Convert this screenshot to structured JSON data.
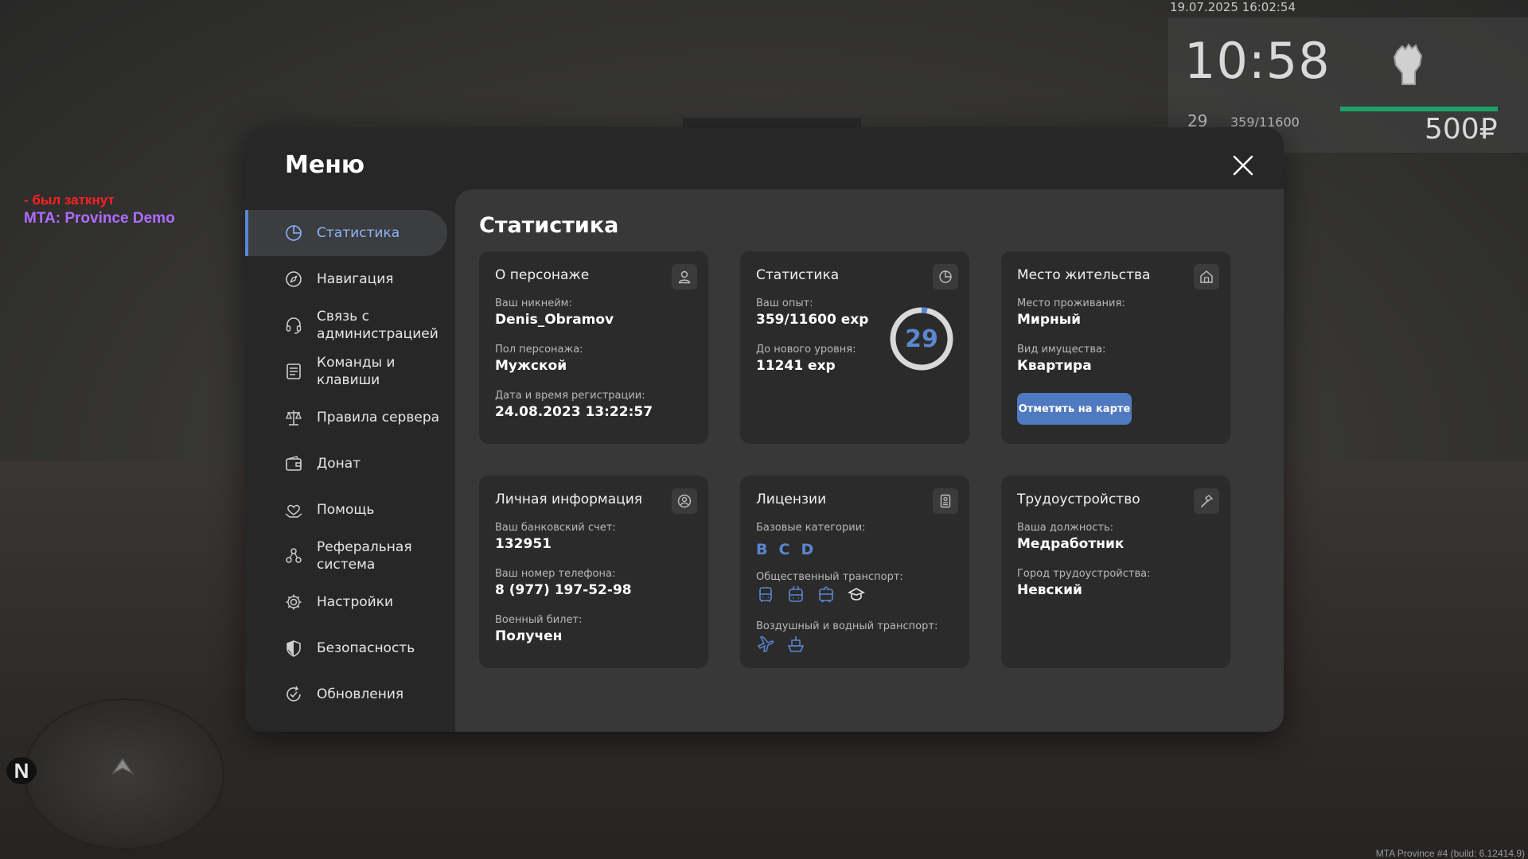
{
  "hud": {
    "datetime": "19.07.2025 16:02:54",
    "time": "10:58",
    "level": "29",
    "xp": "359/11600",
    "money": "500₽",
    "build": "MTA Province #4 (build: 6.12414.9)"
  },
  "chat": {
    "line1": "- был заткнут",
    "line2": "MTA: Province Demo"
  },
  "radar": {
    "north": "N"
  },
  "menu": {
    "title": "Меню",
    "sidebar": [
      {
        "label": "Статистика",
        "icon": "pie-chart-icon"
      },
      {
        "label": "Навигация",
        "icon": "compass-icon"
      },
      {
        "label": "Связь с администрацией",
        "icon": "headset-icon"
      },
      {
        "label": "Команды и клавиши",
        "icon": "list-icon"
      },
      {
        "label": "Правила сервера",
        "icon": "scales-icon"
      },
      {
        "label": "Донат",
        "icon": "wallet-icon"
      },
      {
        "label": "Помощь",
        "icon": "heart-hand-icon"
      },
      {
        "label": "Реферальная система",
        "icon": "referral-icon"
      },
      {
        "label": "Настройки",
        "icon": "gear-icon"
      },
      {
        "label": "Безопасность",
        "icon": "shield-icon"
      },
      {
        "label": "Обновления",
        "icon": "refresh-check-icon"
      }
    ]
  },
  "content": {
    "title": "Статистика",
    "about": {
      "title": "О персонаже",
      "nick_label": "Ваш никнейм:",
      "nick": "Denis_Obramov",
      "gender_label": "Пол персонажа:",
      "gender": "Мужской",
      "reg_label": "Дата и время регистрации:",
      "reg": "24.08.2023 13:22:57"
    },
    "stats": {
      "title": "Статистика",
      "xp_label": "Ваш опыт:",
      "xp": "359/11600 exp",
      "next_label": "До нового уровня:",
      "next": "11241 exp",
      "level": "29",
      "progress": 0.031
    },
    "residence": {
      "title": "Место жительства",
      "place_label": "Место проживания:",
      "place": "Мирный",
      "type_label": "Вид имущества:",
      "type": "Квартира",
      "button": "Отметить на карте"
    },
    "personal": {
      "title": "Личная информация",
      "bank_label": "Ваш банковский счет:",
      "bank": "132951",
      "phone_label": "Ваш номер телефона:",
      "phone": "8 (977) 197-52-98",
      "military_label": "Военный билет:",
      "military": "Получен"
    },
    "licenses": {
      "title": "Лицензии",
      "base_label": "Базовые категории:",
      "categories": [
        "B",
        "C",
        "D"
      ],
      "public_label": "Общественный транспорт:",
      "air_label": "Воздушный и водный транспорт:"
    },
    "job": {
      "title": "Трудоустройство",
      "position_label": "Ваша должность:",
      "position": "Медработник",
      "city_label": "Город трудоустройства:",
      "city": "Невский"
    }
  },
  "colors": {
    "accent": "#5b86d0",
    "button": "#4f79c0",
    "health": "#1f9f6a"
  }
}
